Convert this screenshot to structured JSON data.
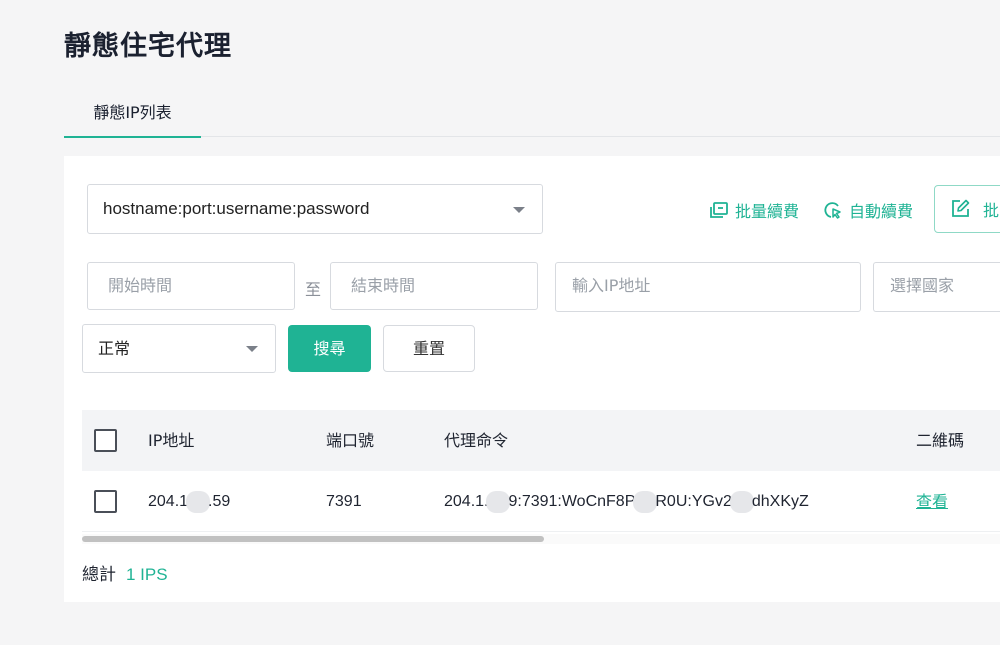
{
  "page": {
    "title": "靜態住宅代理"
  },
  "tabs": [
    {
      "label": "靜態IP列表",
      "active": true
    }
  ],
  "toolbar": {
    "format_select": {
      "value": "hostname:port:username:password"
    },
    "batch_renew_label": "批量續費",
    "auto_renew_label": "自動續費",
    "batch_edit_label": "批"
  },
  "filters": {
    "start_time_placeholder": "開始時間",
    "range_separator": "至",
    "end_time_placeholder": "結束時間",
    "ip_placeholder": "輸入IP地址",
    "country_placeholder": "選擇國家",
    "status_select": {
      "value": "正常"
    },
    "search_label": "搜尋",
    "reset_label": "重置"
  },
  "table": {
    "columns": [
      "IP地址",
      "端口號",
      "代理命令",
      "二維碼"
    ],
    "rows": [
      {
        "ip_start": "204.1",
        "ip_end": ".59",
        "port": "7391",
        "cmd_part1": "204.1.",
        "cmd_part2": "9:7391:WoCnF8P",
        "cmd_part3": "R0U:YGv2",
        "cmd_part4": "dhXKyZ",
        "qr_link": "查看"
      }
    ]
  },
  "footer": {
    "total_label": "總計",
    "total_value": "1 IPS"
  },
  "colors": {
    "accent": "#1fb394",
    "background": "#f5f5f6"
  }
}
